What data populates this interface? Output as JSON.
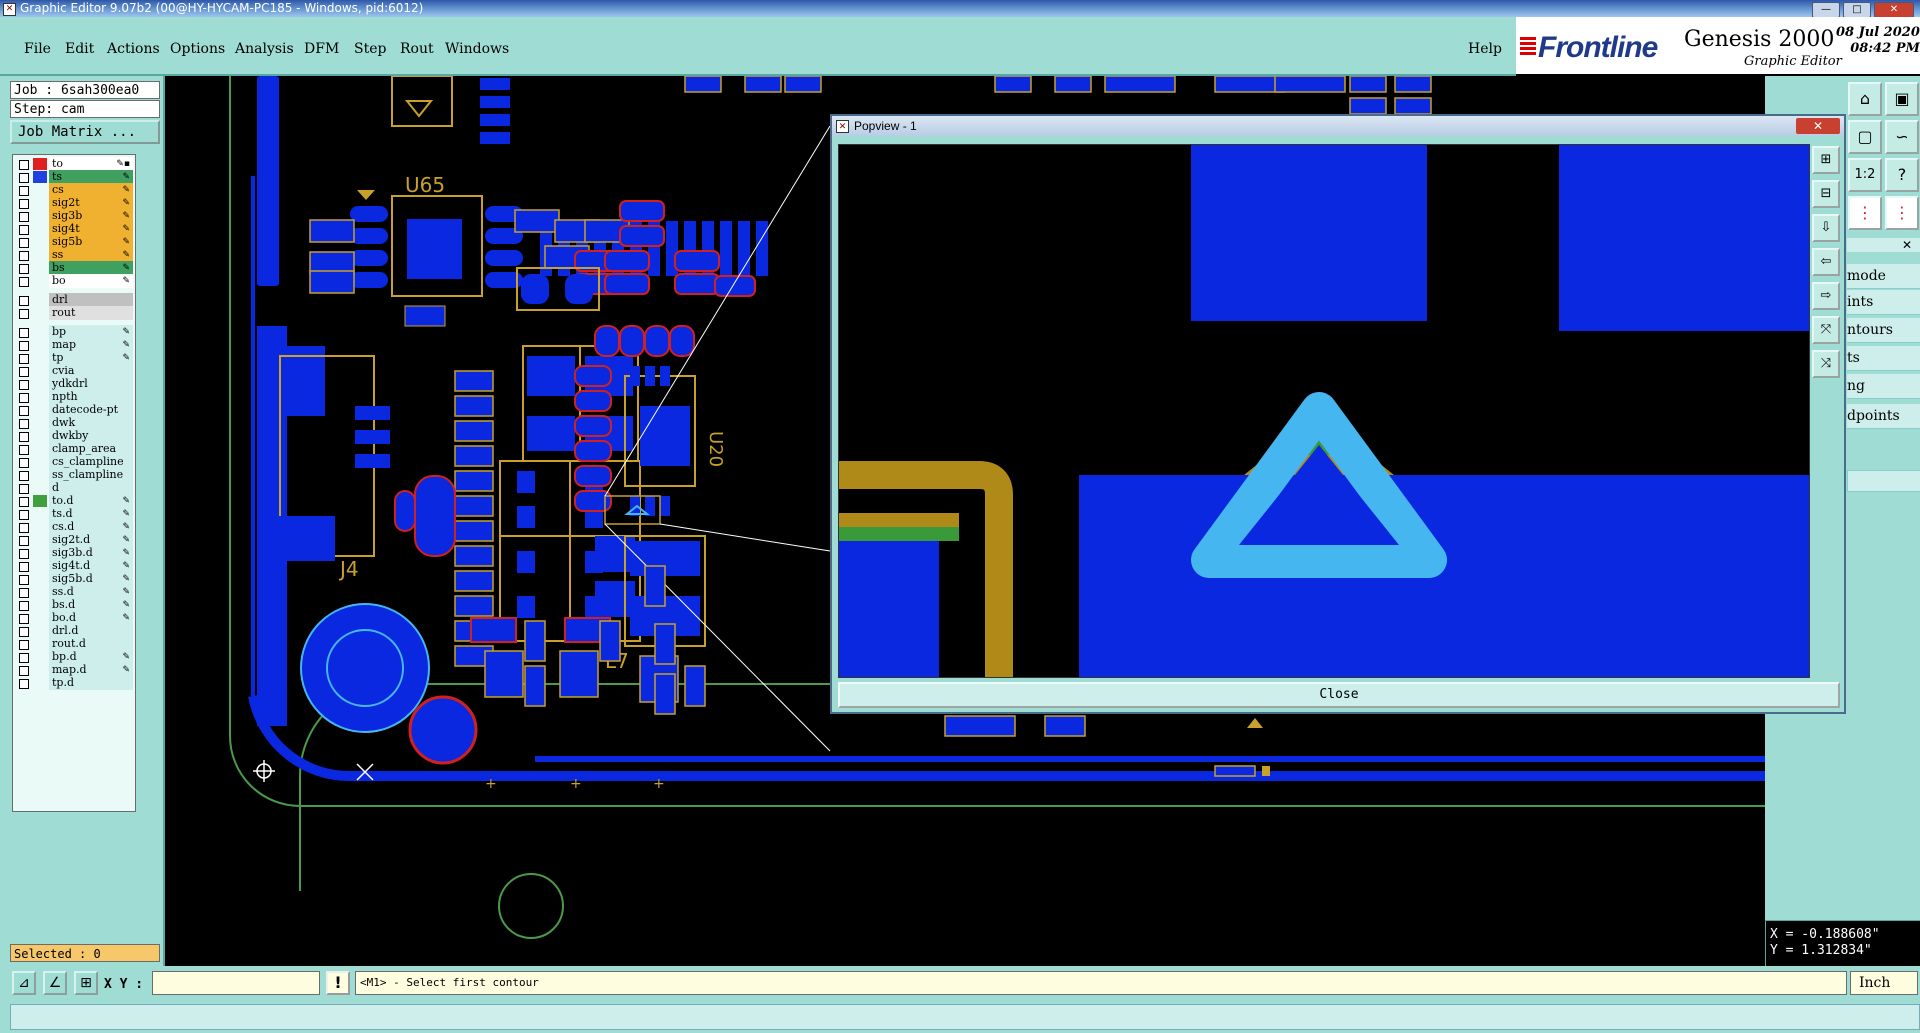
{
  "window": {
    "title": "Graphic Editor 9.07b2 (00@HY-HYCAM-PC185 - Windows, pid:6012)",
    "controls": [
      "—",
      "□",
      "✕"
    ]
  },
  "menu": {
    "items": [
      "File",
      "Edit",
      "Actions",
      "Options",
      "Analysis",
      "DFM",
      "Step",
      "Rout",
      "Windows"
    ],
    "help": "Help"
  },
  "logo": {
    "brand": "Frontline",
    "product": "Genesis 2000",
    "subtitle": "Graphic Editor",
    "date": "08 Jul 2020",
    "time": "08:42 PM"
  },
  "job": {
    "job_text": "Job : 6sah300ea0",
    "step_text": "Step: cam",
    "matrix_button": "Job Matrix ..."
  },
  "layers": [
    {
      "name": "to",
      "color": "#ffffff",
      "swatch": "#e02020",
      "pen": "✎▪"
    },
    {
      "name": "ts",
      "color": "#40a060",
      "swatch": "#2040e0",
      "pen": "✎"
    },
    {
      "name": "cs",
      "color": "#f0b030",
      "swatch": "",
      "pen": "✎"
    },
    {
      "name": "sig2t",
      "color": "#f0b030",
      "swatch": "",
      "pen": "✎"
    },
    {
      "name": "sig3b",
      "color": "#f0b030",
      "swatch": "",
      "pen": "✎"
    },
    {
      "name": "sig4t",
      "color": "#f0b030",
      "swatch": "",
      "pen": "✎"
    },
    {
      "name": "sig5b",
      "color": "#f0b030",
      "swatch": "",
      "pen": "✎"
    },
    {
      "name": "ss",
      "color": "#f0b030",
      "swatch": "",
      "pen": "✎"
    },
    {
      "name": "bs",
      "color": "#40a060",
      "swatch": "",
      "pen": "✎"
    },
    {
      "name": "bo",
      "color": "#ffffff",
      "swatch": "",
      "pen": "✎"
    },
    {
      "name": "drl",
      "color": "#c0c0c0",
      "swatch": "",
      "pen": ""
    },
    {
      "name": "rout",
      "color": "#e0e0e0",
      "swatch": "",
      "pen": ""
    },
    {
      "name": "bp",
      "color": "#cdeeea",
      "swatch": "",
      "pen": "✎"
    },
    {
      "name": "map",
      "color": "#cdeeea",
      "swatch": "",
      "pen": "✎"
    },
    {
      "name": "tp",
      "color": "#cdeeea",
      "swatch": "",
      "pen": "✎"
    },
    {
      "name": "cvia",
      "color": "#cdeeea",
      "swatch": "",
      "pen": ""
    },
    {
      "name": "ydkdrl",
      "color": "#cdeeea",
      "swatch": "",
      "pen": ""
    },
    {
      "name": "npth",
      "color": "#cdeeea",
      "swatch": "",
      "pen": ""
    },
    {
      "name": "datecode-pt",
      "color": "#cdeeea",
      "swatch": "",
      "pen": ""
    },
    {
      "name": "dwk",
      "color": "#cdeeea",
      "swatch": "",
      "pen": ""
    },
    {
      "name": "dwkby",
      "color": "#cdeeea",
      "swatch": "",
      "pen": ""
    },
    {
      "name": "clamp_area",
      "color": "#cdeeea",
      "swatch": "",
      "pen": ""
    },
    {
      "name": "cs_clampline",
      "color": "#cdeeea",
      "swatch": "",
      "pen": ""
    },
    {
      "name": "ss_clampline",
      "color": "#cdeeea",
      "swatch": "",
      "pen": ""
    },
    {
      "name": "d",
      "color": "#cdeeea",
      "swatch": "",
      "pen": ""
    },
    {
      "name": "to.d",
      "color": "#cdeeea",
      "swatch": "#40a040",
      "pen": "✎"
    },
    {
      "name": "ts.d",
      "color": "#cdeeea",
      "swatch": "",
      "pen": "✎"
    },
    {
      "name": "cs.d",
      "color": "#cdeeea",
      "swatch": "",
      "pen": "✎"
    },
    {
      "name": "sig2t.d",
      "color": "#cdeeea",
      "swatch": "",
      "pen": "✎"
    },
    {
      "name": "sig3b.d",
      "color": "#cdeeea",
      "swatch": "",
      "pen": "✎"
    },
    {
      "name": "sig4t.d",
      "color": "#cdeeea",
      "swatch": "",
      "pen": "✎"
    },
    {
      "name": "sig5b.d",
      "color": "#cdeeea",
      "swatch": "",
      "pen": "✎"
    },
    {
      "name": "ss.d",
      "color": "#cdeeea",
      "swatch": "",
      "pen": "✎"
    },
    {
      "name": "bs.d",
      "color": "#cdeeea",
      "swatch": "",
      "pen": "✎"
    },
    {
      "name": "bo.d",
      "color": "#cdeeea",
      "swatch": "",
      "pen": "✎"
    },
    {
      "name": "drl.d",
      "color": "#cdeeea",
      "swatch": "",
      "pen": ""
    },
    {
      "name": "rout.d",
      "color": "#cdeeea",
      "swatch": "",
      "pen": ""
    },
    {
      "name": "bp.d",
      "color": "#cdeeea",
      "swatch": "",
      "pen": "✎"
    },
    {
      "name": "map.d",
      "color": "#cdeeea",
      "swatch": "",
      "pen": "✎"
    },
    {
      "name": "tp.d",
      "color": "#cdeeea",
      "swatch": "",
      "pen": ""
    }
  ],
  "selected": "Selected : 0",
  "board_labels": {
    "u65": "U65",
    "j4": "J4",
    "l7": "L7",
    "u20": "U20"
  },
  "popview": {
    "title": "Popview - 1",
    "close_label": "Close"
  },
  "right_panel": {
    "ratio_label": "1:2",
    "help_label": "?",
    "list": [
      "mode",
      "ints",
      "ntours",
      "ts",
      "ng",
      "dpoints"
    ]
  },
  "coords": {
    "x": "X = -0.188608\"",
    "y": "Y = 1.312834\""
  },
  "bottom": {
    "xy_label": "X Y :",
    "xy_value": "",
    "bang": "!",
    "prompt": "<M1> - Select first contour",
    "unit": "Inch"
  },
  "colors": {
    "panel": "#9fdcd3",
    "pad": "#0a28e0",
    "outline": "#c8a02a",
    "highlight": "#46b6f0"
  }
}
